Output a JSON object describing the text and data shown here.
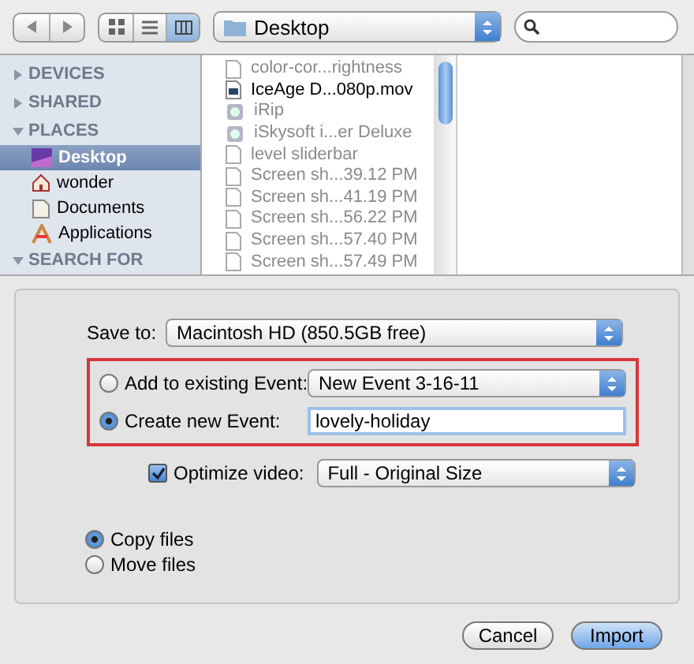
{
  "toolbar": {
    "location": "Desktop",
    "views": [
      {
        "kind": "icons",
        "selected": false
      },
      {
        "kind": "list",
        "selected": false
      },
      {
        "kind": "columns",
        "selected": true
      }
    ]
  },
  "sidebar": {
    "sections": [
      {
        "title": "DEVICES",
        "expanded": false
      },
      {
        "title": "SHARED",
        "expanded": false
      },
      {
        "title": "PLACES",
        "expanded": true,
        "items": [
          {
            "label": "Desktop",
            "kind": "desktop",
            "selected": true
          },
          {
            "label": "wonder",
            "kind": "home",
            "selected": false
          },
          {
            "label": "Documents",
            "kind": "documents",
            "selected": false
          },
          {
            "label": "Applications",
            "kind": "applications",
            "selected": false
          }
        ]
      },
      {
        "title": "SEARCH FOR",
        "expanded": true
      }
    ]
  },
  "files": [
    {
      "name": "color-cor...rightness",
      "kind": "document",
      "disabled": true
    },
    {
      "name": "IceAge D...080p.mov",
      "kind": "movie",
      "disabled": false
    },
    {
      "name": "iRip",
      "kind": "app",
      "disabled": true
    },
    {
      "name": "iSkysoft i...er Deluxe",
      "kind": "app",
      "disabled": true
    },
    {
      "name": "level sliderbar",
      "kind": "document",
      "disabled": true
    },
    {
      "name": "Screen sh...39.12 PM",
      "kind": "document",
      "disabled": true
    },
    {
      "name": "Screen sh...41.19 PM",
      "kind": "document",
      "disabled": true
    },
    {
      "name": "Screen sh...56.22 PM",
      "kind": "document",
      "disabled": true
    },
    {
      "name": "Screen sh...57.40 PM",
      "kind": "document",
      "disabled": true
    },
    {
      "name": "Screen sh...57.49 PM",
      "kind": "document",
      "disabled": true
    }
  ],
  "save_to": {
    "label": "Save to:",
    "value": "Macintosh HD (850.5GB free)"
  },
  "event": {
    "add_existing": {
      "label": "Add to existing Event:",
      "selected": false,
      "value": "New Event 3-16-11"
    },
    "create_new": {
      "label": "Create new Event:",
      "selected": true,
      "value": "lovely-holiday"
    }
  },
  "optimize": {
    "label": "Optimize video:",
    "checked": true,
    "value": "Full - Original Size"
  },
  "file_mode": [
    {
      "label": "Copy files",
      "selected": true
    },
    {
      "label": "Move files",
      "selected": false
    }
  ],
  "buttons": [
    {
      "label": "Cancel",
      "kind": "secondary"
    },
    {
      "label": "Import",
      "kind": "primary"
    }
  ]
}
